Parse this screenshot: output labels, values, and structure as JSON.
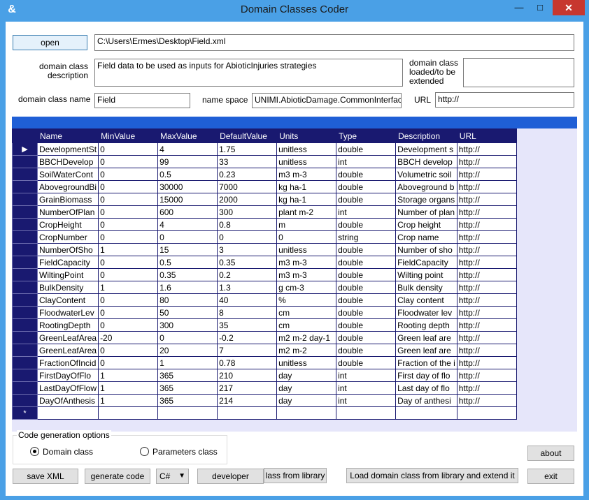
{
  "window": {
    "title": "Domain Classes Coder",
    "app_icon": "app-logo-icon",
    "minimize": "0",
    "maximize": "1",
    "close": "r"
  },
  "file": {
    "open_label": "open",
    "path": "C:\\Users\\Ermes\\Desktop\\Field.xml"
  },
  "description": {
    "label": "domain class description",
    "value": "Field data to be used as inputs for AbioticInjuries strategies"
  },
  "loaded": {
    "label": "domain class loaded/to be extended",
    "value": ""
  },
  "class_name": {
    "label": "domain class name",
    "value": "Field"
  },
  "namespace": {
    "label": "name space",
    "value": "UNIMI.AbioticDamage.CommonInterfaces"
  },
  "url": {
    "label": "URL",
    "value": "http://"
  },
  "grid": {
    "columns": [
      "Name",
      "MinValue",
      "MaxValue",
      "DefaultValue",
      "Units",
      "Type",
      "Description",
      "URL"
    ],
    "current_row_marker": "▶",
    "new_row_marker": "*",
    "rows": [
      [
        "DevelopmentSt",
        "0",
        "4",
        "1.75",
        "unitless",
        "double",
        "Development s",
        "http://"
      ],
      [
        "BBCHDevelop",
        "0",
        "99",
        "33",
        "unitless",
        "int",
        "BBCH develop",
        "http://"
      ],
      [
        "SoilWaterCont",
        "0",
        "0.5",
        "0.23",
        "m3 m-3",
        "double",
        "Volumetric soil",
        "http://"
      ],
      [
        "AbovegroundBi",
        "0",
        "30000",
        "7000",
        "kg ha-1",
        "double",
        "Aboveground b",
        "http://"
      ],
      [
        "GrainBiomass",
        "0",
        "15000",
        "2000",
        "kg ha-1",
        "double",
        "Storage organs",
        "http://"
      ],
      [
        "NumberOfPlan",
        "0",
        "600",
        "300",
        "plant m-2",
        "int",
        "Number of plan",
        "http://"
      ],
      [
        "CropHeight",
        "0",
        "4",
        "0.8",
        "m",
        "double",
        "Crop height",
        "http://"
      ],
      [
        "CropNumber",
        "0",
        "0",
        "0",
        "0",
        "string",
        "Crop name",
        "http://"
      ],
      [
        "NumberOfSho",
        "1",
        "15",
        "3",
        "unitless",
        "double",
        "Number of sho",
        "http://"
      ],
      [
        "FieldCapacity",
        "0",
        "0.5",
        "0.35",
        "m3 m-3",
        "double",
        "FieldCapacity",
        "http://"
      ],
      [
        "WiltingPoint",
        "0",
        "0.35",
        "0.2",
        "m3 m-3",
        "double",
        "Wilting point",
        "http://"
      ],
      [
        "BulkDensity",
        "1",
        "1.6",
        "1.3",
        "g cm-3",
        "double",
        "Bulk density",
        "http://"
      ],
      [
        "ClayContent",
        "0",
        "80",
        "40",
        "%",
        "double",
        "Clay content",
        "http://"
      ],
      [
        "FloodwaterLev",
        "0",
        "50",
        "8",
        "cm",
        "double",
        "Floodwater lev",
        "http://"
      ],
      [
        "RootingDepth",
        "0",
        "300",
        "35",
        "cm",
        "double",
        "Rooting depth",
        "http://"
      ],
      [
        "GreenLeafArea",
        "-20",
        "0",
        "-0.2",
        "m2 m-2 day-1",
        "double",
        "Green leaf are",
        "http://"
      ],
      [
        "GreenLeafArea",
        "0",
        "20",
        "7",
        "m2 m-2",
        "double",
        "Green leaf are",
        "http://"
      ],
      [
        "FractionOfIncid",
        "0",
        "1",
        "0.78",
        "unitless",
        "double",
        "Fraction of the i",
        "http://"
      ],
      [
        "FirstDayOfFlo",
        "1",
        "365",
        "210",
        "day",
        "int",
        "First day of flo",
        "http://"
      ],
      [
        "LastDayOfFlow",
        "1",
        "365",
        "217",
        "day",
        "int",
        "Last day of flo",
        "http://"
      ],
      [
        "DayOfAnthesis",
        "1",
        "365",
        "214",
        "day",
        "int",
        "Day of anthesi",
        "http://"
      ]
    ]
  },
  "options": {
    "title": "Code generation options",
    "domain_class": "Domain class",
    "parameters_class": "Parameters class",
    "selected": "domain_class"
  },
  "buttons": {
    "about": "about",
    "save_xml": "save XML",
    "generate_code": "generate code",
    "language": "C#",
    "developer": "developer",
    "class_from_library": "lass from library",
    "load_extend": "Load domain class from library and extend it",
    "exit": "exit"
  }
}
